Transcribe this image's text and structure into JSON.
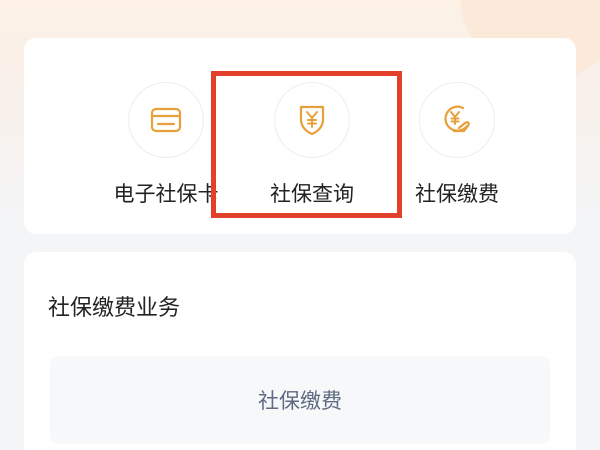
{
  "services": [
    {
      "label": "电子社保卡",
      "icon": "social-security-card-icon"
    },
    {
      "label": "社保查询",
      "icon": "yuan-shield-icon"
    },
    {
      "label": "社保缴费",
      "icon": "yuan-coin-hand-icon"
    }
  ],
  "business": {
    "title": "社保缴费业务",
    "button_label": "社保缴费"
  },
  "colors": {
    "icon_accent": "#e8a03a",
    "highlight": "#e3402b"
  }
}
